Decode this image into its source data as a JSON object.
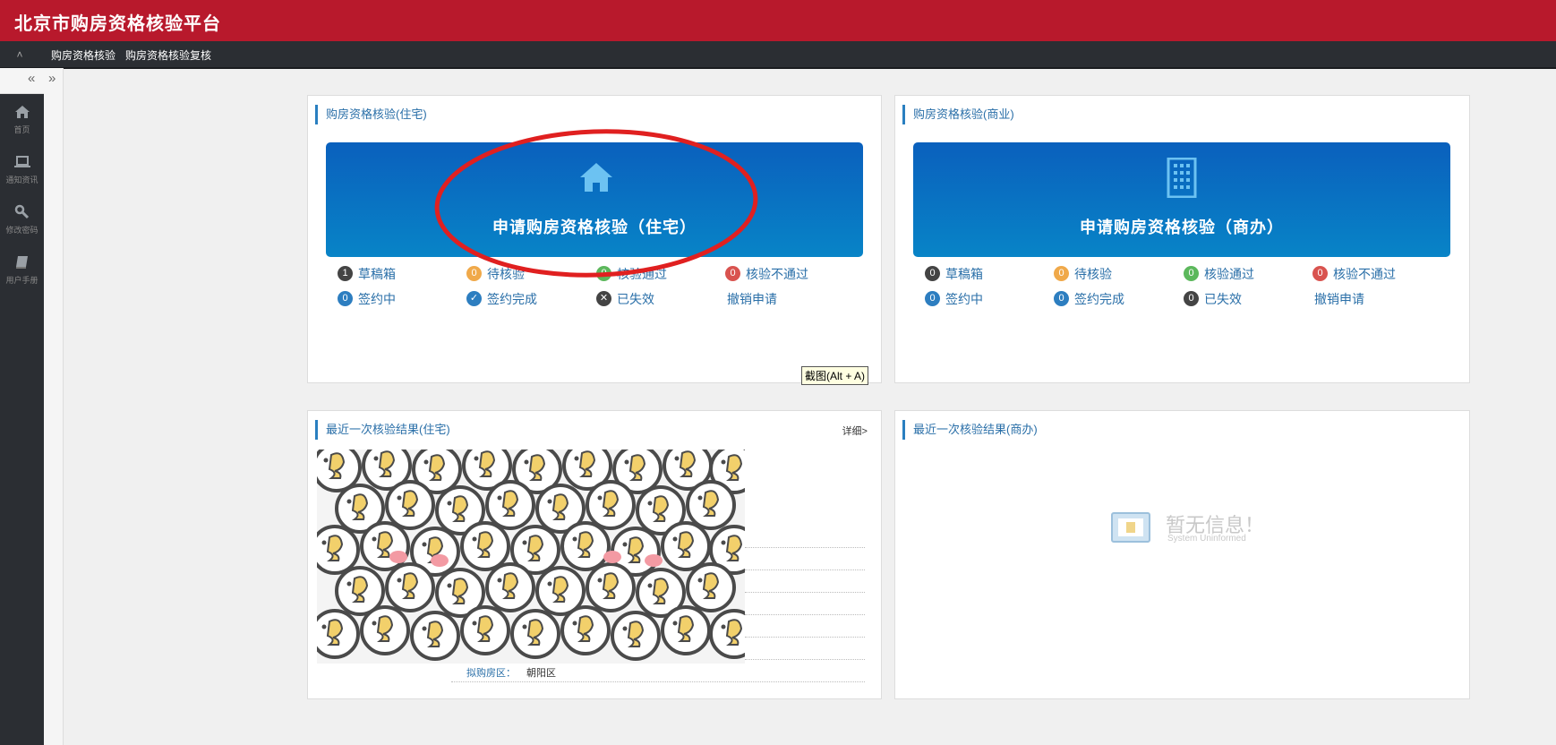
{
  "app": {
    "title": "北京市购房资格核验平台"
  },
  "nav": {
    "items": [
      "购房资格核验",
      "购房资格核验复核"
    ]
  },
  "sidebar": {
    "items": [
      {
        "label": "首页",
        "icon": "home-icon"
      },
      {
        "label": "通知资讯",
        "icon": "laptop-icon"
      },
      {
        "label": "修改密码",
        "icon": "wrench-icon"
      },
      {
        "label": "用户手册",
        "icon": "book-icon"
      }
    ]
  },
  "residential": {
    "title": "购房资格核验(住宅)",
    "button": "申请购房资格核验（住宅）",
    "statuses": {
      "draft": {
        "count": "1",
        "label": "草稿箱"
      },
      "pending": {
        "count": "0",
        "label": "待核验"
      },
      "passed": {
        "count": "0",
        "label": "核验通过"
      },
      "failed": {
        "count": "0",
        "label": "核验不通过"
      },
      "signing": {
        "count": "0",
        "label": "签约中"
      },
      "signed": {
        "label": "签约完成"
      },
      "expired": {
        "label": "已失效"
      },
      "revoke": {
        "label": "撤销申请"
      }
    }
  },
  "commercial": {
    "title": "购房资格核验(商业)",
    "button": "申请购房资格核验（商办）",
    "statuses": {
      "draft": {
        "count": "0",
        "label": "草稿箱"
      },
      "pending": {
        "count": "0",
        "label": "待核验"
      },
      "passed": {
        "count": "0",
        "label": "核验通过"
      },
      "failed": {
        "count": "0",
        "label": "核验不通过"
      },
      "signing": {
        "count": "0",
        "label": "签约中"
      },
      "signed": {
        "count": "0",
        "label": "签约完成"
      },
      "expired": {
        "count": "0",
        "label": "已失效"
      },
      "revoke": {
        "label": "撤销申请"
      }
    }
  },
  "tooltip": {
    "text": "截图(Alt + A)"
  },
  "recent_residential": {
    "title": "最近一次核验结果(住宅)",
    "details_link": "详细>",
    "field_label": "拟购房区：",
    "field_value": "朝阳区"
  },
  "recent_commercial": {
    "title": "最近一次核验结果(商办)",
    "empty_text": "暂无信息！",
    "empty_sub": "System Uninformed"
  },
  "colors": {
    "brand_red": "#b8192c",
    "banner_blue": "#0a6fc2",
    "annotation_red": "#e02020"
  }
}
